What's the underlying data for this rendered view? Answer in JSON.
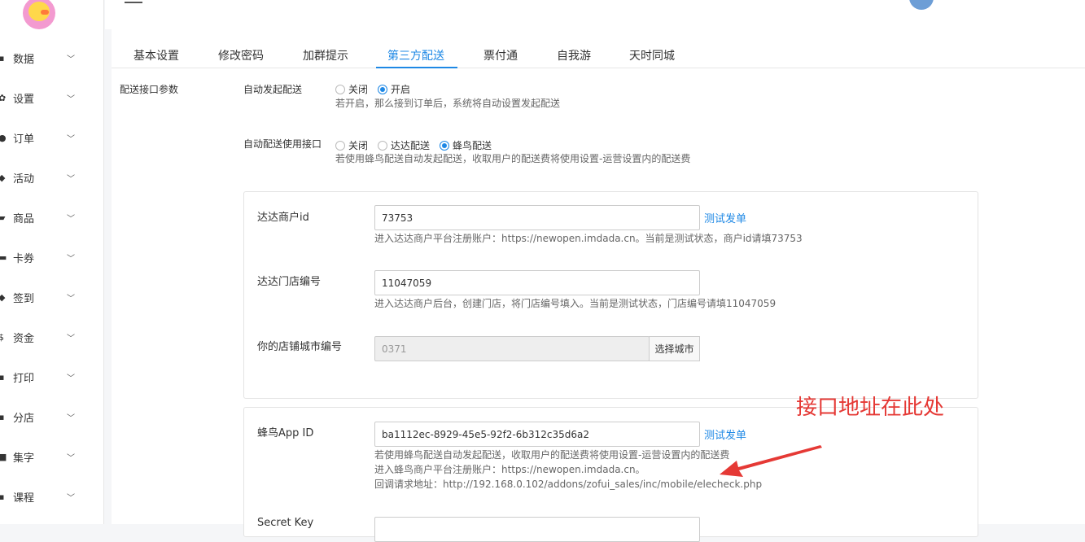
{
  "sidebar": {
    "items": [
      {
        "label": "数据",
        "icon": "chart-icon"
      },
      {
        "label": "设置",
        "icon": "gear-icon"
      },
      {
        "label": "订单",
        "icon": "order-icon"
      },
      {
        "label": "活动",
        "icon": "tag-icon"
      },
      {
        "label": "商品",
        "icon": "bag-icon"
      },
      {
        "label": "卡券",
        "icon": "card-icon"
      },
      {
        "label": "签到",
        "icon": "cube-icon"
      },
      {
        "label": "资金",
        "icon": "dollar-icon"
      },
      {
        "label": "打印",
        "icon": "printer-icon"
      },
      {
        "label": "分店",
        "icon": "branch-icon"
      },
      {
        "label": "集字",
        "icon": "collect-icon"
      },
      {
        "label": "课程",
        "icon": "course-icon"
      }
    ]
  },
  "tabs": [
    "基本设置",
    "修改密码",
    "加群提示",
    "第三方配送",
    "票付通",
    "自我游",
    "天时同城"
  ],
  "section_label": "配送接口参数",
  "auto_dispatch": {
    "label": "自动发起配送",
    "options": [
      "关闭",
      "开启"
    ],
    "selected": 1,
    "help": "若开启，那么接到订单后，系统将自动设置发起配送"
  },
  "auto_interface": {
    "label": "自动配送使用接口",
    "options": [
      "关闭",
      "达达配送",
      "蜂鸟配送"
    ],
    "selected": 2,
    "help": "若使用蜂鸟配送自动发起配送，收取用户的配送费将使用设置-运营设置内的配送费"
  },
  "dada": {
    "merchant_label": "达达商户id",
    "merchant_value": "73753",
    "test_link": "测试发单",
    "merchant_help": "进入达达商户平台注册账户：https://newopen.imdada.cn。当前是测试状态，商户id请填73753",
    "store_label": "达达门店编号",
    "store_value": "11047059",
    "store_help": "进入达达商户后台，创建门店，将门店编号填入。当前是测试状态，门店编号请填11047059",
    "city_label": "你的店铺城市编号",
    "city_value": "0371",
    "city_button": "选择城市"
  },
  "fengniao": {
    "appid_label": "蜂鸟App ID",
    "appid_value": "ba1112ec-8929-45e5-92f2-6b312c35d6a2",
    "test_link": "测试发单",
    "help1": "若使用蜂鸟配送自动发起配送，收取用户的配送费将使用设置-运营设置内的配送费",
    "help2": "进入蜂鸟商户平台注册账户：https://newopen.imdada.cn。",
    "help3": "回调请求地址：http://192.168.0.102/addons/zofui_sales/inc/mobile/elecheck.php",
    "secret_label": "Secret Key"
  },
  "annotation": "接口地址在此处",
  "colors": {
    "accent": "#1e88e5",
    "annotation": "#e53935"
  }
}
